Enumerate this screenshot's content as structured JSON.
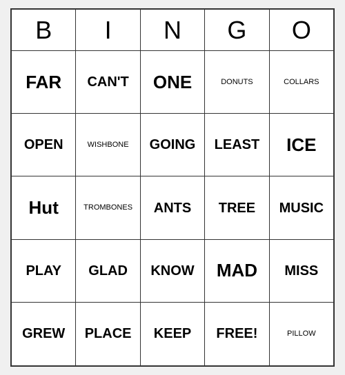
{
  "header": {
    "letters": [
      "B",
      "I",
      "N",
      "G",
      "O"
    ]
  },
  "rows": [
    [
      {
        "text": "FAR",
        "size": "large"
      },
      {
        "text": "CAN'T",
        "size": "medium"
      },
      {
        "text": "ONE",
        "size": "large"
      },
      {
        "text": "DONUTS",
        "size": "small"
      },
      {
        "text": "COLLARS",
        "size": "small"
      }
    ],
    [
      {
        "text": "OPEN",
        "size": "medium"
      },
      {
        "text": "WISHBONE",
        "size": "small"
      },
      {
        "text": "GOING",
        "size": "medium"
      },
      {
        "text": "LEAST",
        "size": "medium"
      },
      {
        "text": "ICE",
        "size": "large"
      }
    ],
    [
      {
        "text": "Hut",
        "size": "large"
      },
      {
        "text": "TROMBONES",
        "size": "small"
      },
      {
        "text": "ANTS",
        "size": "medium"
      },
      {
        "text": "TREE",
        "size": "medium"
      },
      {
        "text": "MUSIC",
        "size": "medium"
      }
    ],
    [
      {
        "text": "PLAY",
        "size": "medium"
      },
      {
        "text": "GLAD",
        "size": "medium"
      },
      {
        "text": "KNOW",
        "size": "medium"
      },
      {
        "text": "MAD",
        "size": "large"
      },
      {
        "text": "MISS",
        "size": "medium"
      }
    ],
    [
      {
        "text": "GREW",
        "size": "medium"
      },
      {
        "text": "PLACE",
        "size": "medium"
      },
      {
        "text": "KEEP",
        "size": "medium"
      },
      {
        "text": "FREE!",
        "size": "medium"
      },
      {
        "text": "PILLOW",
        "size": "small"
      }
    ]
  ]
}
